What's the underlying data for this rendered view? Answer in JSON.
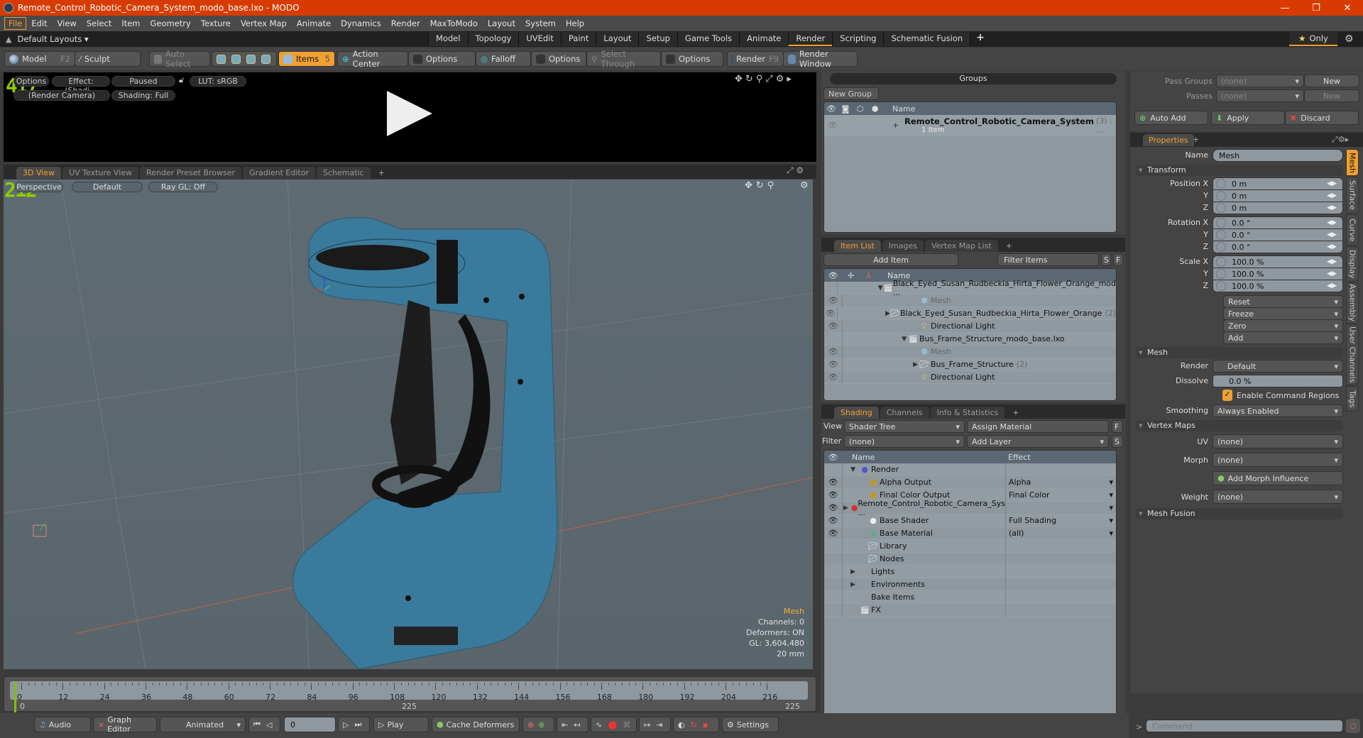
{
  "window": {
    "title": "Remote_Control_Robotic_Camera_System_modo_base.lxo - MODO",
    "minimize": "—",
    "restore": "❐",
    "close": "✕"
  },
  "menu": [
    "File",
    "Edit",
    "View",
    "Select",
    "Item",
    "Geometry",
    "Texture",
    "Vertex Map",
    "Animate",
    "Dynamics",
    "Render",
    "MaxToModo",
    "Layout",
    "System",
    "Help"
  ],
  "layout": {
    "default_layouts": "Default Layouts ▾",
    "tabs": [
      "Model",
      "Topology",
      "UVEdit",
      "Paint",
      "Layout",
      "Setup",
      "Game Tools",
      "Animate",
      "Render",
      "Scripting",
      "Schematic Fusion"
    ],
    "selected_tab": "Render",
    "add": "+",
    "only": "Only"
  },
  "toolbar": {
    "model": "Model",
    "model_key": "F2",
    "sculpt": "Sculpt",
    "auto_select": "Auto Select",
    "items": "Items",
    "items_count": "5",
    "action_center": "Action Center",
    "options1": "Options",
    "falloff": "Falloff",
    "options2": "Options",
    "select_through": "Select Through",
    "options3": "Options",
    "render": "Render",
    "render_key": "F9",
    "render_window": "Render Window"
  },
  "preview": {
    "options": "Options",
    "effect": "Effect: (Shadi...",
    "paused": "Paused",
    "lut": "LUT: sRGB",
    "camera": "(Render Camera)",
    "shading": "Shading: Full",
    "fps_number": "417"
  },
  "view_tabs": [
    "3D View",
    "UV Texture View",
    "Render Preset Browser",
    "Gradient Editor",
    "Schematic"
  ],
  "viewport": {
    "perspective": "Perspective",
    "default": "Default",
    "raygl": "Ray GL: Off",
    "fps_number": "212",
    "stats": {
      "mesh": "Mesh",
      "channels": "Channels: 0",
      "deformers": "Deformers: ON",
      "gl": "GL: 3,604,480",
      "scale": "20 mm"
    }
  },
  "groups": {
    "title": "Groups",
    "new_group": "New Group",
    "name_header": "Name",
    "item_name": "Remote_Control_Robotic_Camera_System",
    "item_suffix": "(3) : ...",
    "item_sub": "1 Item"
  },
  "item_list": {
    "tabs": [
      "Item List",
      "Images",
      "Vertex Map List"
    ],
    "add_item": "Add Item",
    "filter": "Filter Items",
    "s": "S",
    "f": "F",
    "name_header": "Name",
    "rows": [
      {
        "indent": 0,
        "expand": "▼",
        "icon": "scene",
        "label": "Black_Eyed_Susan_Rudbeckia_Hirta_Flower_Orange_mod ...",
        "eye": false,
        "dim": false,
        "count": ""
      },
      {
        "indent": 1,
        "expand": "",
        "icon": "mesh",
        "label": "Mesh",
        "eye": true,
        "dim": true,
        "count": ""
      },
      {
        "indent": 1,
        "expand": "▶",
        "icon": "folder",
        "label": "Black_Eyed_Susan_Rudbeckia_Hirta_Flower_Orange",
        "eye": true,
        "dim": false,
        "count": "(2)"
      },
      {
        "indent": 1,
        "expand": "",
        "icon": "light",
        "label": "Directional Light",
        "eye": true,
        "dim": false,
        "count": ""
      },
      {
        "indent": 0,
        "expand": "▼",
        "icon": "scene",
        "label": "Bus_Frame_Structure_modo_base.lxo",
        "eye": false,
        "dim": false,
        "count": ""
      },
      {
        "indent": 1,
        "expand": "",
        "icon": "mesh",
        "label": "Mesh",
        "eye": true,
        "dim": true,
        "count": ""
      },
      {
        "indent": 1,
        "expand": "▶",
        "icon": "folder",
        "label": "Bus_Frame_Structure",
        "eye": true,
        "dim": false,
        "count": "(2)"
      },
      {
        "indent": 1,
        "expand": "",
        "icon": "light",
        "label": "Directional Light",
        "eye": true,
        "dim": false,
        "count": ""
      }
    ]
  },
  "shading": {
    "tabs": [
      "Shading",
      "Channels",
      "Info & Statistics"
    ],
    "view_label": "View",
    "view_value": "Shader Tree",
    "assign_material": "Assign Material",
    "filter_label": "Filter",
    "filter_value": "(none)",
    "add_layer": "Add Layer",
    "f": "F",
    "s": "S",
    "name_header": "Name",
    "effect_header": "Effect",
    "rows": [
      {
        "indent": 0,
        "expand": "▼",
        "icon": "render",
        "label": "Render",
        "effect": "",
        "eye": false,
        "dd": false
      },
      {
        "indent": 1,
        "expand": "",
        "icon": "output",
        "label": "Alpha Output",
        "effect": "Alpha",
        "eye": true,
        "dd": true
      },
      {
        "indent": 1,
        "expand": "",
        "icon": "output",
        "label": "Final Color Output",
        "effect": "Final Color",
        "eye": true,
        "dd": true
      },
      {
        "indent": 1,
        "expand": "▶",
        "icon": "matgroup",
        "label": "Remote_Control_Robotic_Camera_Sys ...",
        "effect": "",
        "eye": true,
        "dd": true
      },
      {
        "indent": 1,
        "expand": "",
        "icon": "shader",
        "label": "Base Shader",
        "effect": "Full Shading",
        "eye": true,
        "dd": true
      },
      {
        "indent": 1,
        "expand": "",
        "icon": "material",
        "label": "Base Material",
        "effect": "(all)",
        "eye": true,
        "dd": true
      },
      {
        "indent": 1,
        "expand": "",
        "icon": "folder",
        "label": "Library",
        "effect": "",
        "eye": false,
        "dd": false
      },
      {
        "indent": 1,
        "expand": "",
        "icon": "folder",
        "label": "Nodes",
        "effect": "",
        "eye": false,
        "dd": false
      },
      {
        "indent": 0,
        "expand": "▶",
        "icon": "none",
        "label": "Lights",
        "effect": "",
        "eye": false,
        "dd": false
      },
      {
        "indent": 0,
        "expand": "▶",
        "icon": "none",
        "label": "Environments",
        "effect": "",
        "eye": false,
        "dd": false
      },
      {
        "indent": 0,
        "expand": "",
        "icon": "none",
        "label": "Bake Items",
        "effect": "",
        "eye": false,
        "dd": false
      },
      {
        "indent": 0,
        "expand": "",
        "icon": "scene",
        "label": "FX",
        "effect": "",
        "eye": false,
        "dd": false
      }
    ]
  },
  "passes": {
    "pass_groups_label": "Pass Groups",
    "pass_groups_value": "(none)",
    "passes_label": "Passes",
    "passes_value": "(none)",
    "new": "New",
    "auto_add": "Auto Add",
    "apply": "Apply",
    "discard": "Discard"
  },
  "properties": {
    "tab": "Properties",
    "name_label": "Name",
    "name_value": "Mesh",
    "transform_title": "Transform",
    "position": {
      "label": "Position X",
      "x": "0 m",
      "y": "0 m",
      "z": "0 m"
    },
    "rotation": {
      "label": "Rotation X",
      "x": "0.0 °",
      "y": "0.0 °",
      "z": "0.0 °"
    },
    "scale": {
      "label": "Scale X",
      "x": "100.0 %",
      "y": "100.0 %",
      "z": "100.0 %"
    },
    "axis_y": "Y",
    "axis_z": "Z",
    "actions": [
      "Reset",
      "Freeze",
      "Zero",
      "Add"
    ],
    "mesh_title": "Mesh",
    "render_label": "Render",
    "render_value": "Default",
    "dissolve_label": "Dissolve",
    "dissolve_value": "0.0 %",
    "enable_cmd_regions": "Enable Command Regions",
    "enable_cmd_regions_checked": true,
    "smoothing_label": "Smoothing",
    "smoothing_value": "Always Enabled",
    "vmaps_title": "Vertex Maps",
    "uv_label": "UV",
    "uv_value": "(none)",
    "morph_label": "Morph",
    "morph_value": "(none)",
    "add_morph": "Add Morph Influence",
    "weight_label": "Weight",
    "weight_value": "(none)",
    "mesh_fusion_title": "Mesh Fusion",
    "side_tabs": [
      "Mesh",
      "Surface",
      "Curve",
      "Display",
      "Assembly",
      "User Channels",
      "Tags"
    ]
  },
  "timeline": {
    "ticks": [
      "0",
      "12",
      "24",
      "36",
      "48",
      "60",
      "72",
      "84",
      "96",
      "108",
      "120",
      "132",
      "144",
      "156",
      "168",
      "180",
      "192",
      "204",
      "216"
    ],
    "range_start": "0",
    "range_end": "225",
    "current": 0
  },
  "transport": {
    "audio": "Audio",
    "graph_editor": "Graph Editor",
    "animated": "Animated",
    "frame": "0",
    "play": "Play",
    "cache_deformers": "Cache Deformers",
    "settings": "Settings"
  },
  "command": {
    "prompt": ">",
    "placeholder": "Command"
  },
  "colors": {
    "accent": "#f0a030",
    "title_bar": "#d83b01",
    "mesh_blue": "#3a7a9c",
    "grid_green": "#8fce00"
  }
}
